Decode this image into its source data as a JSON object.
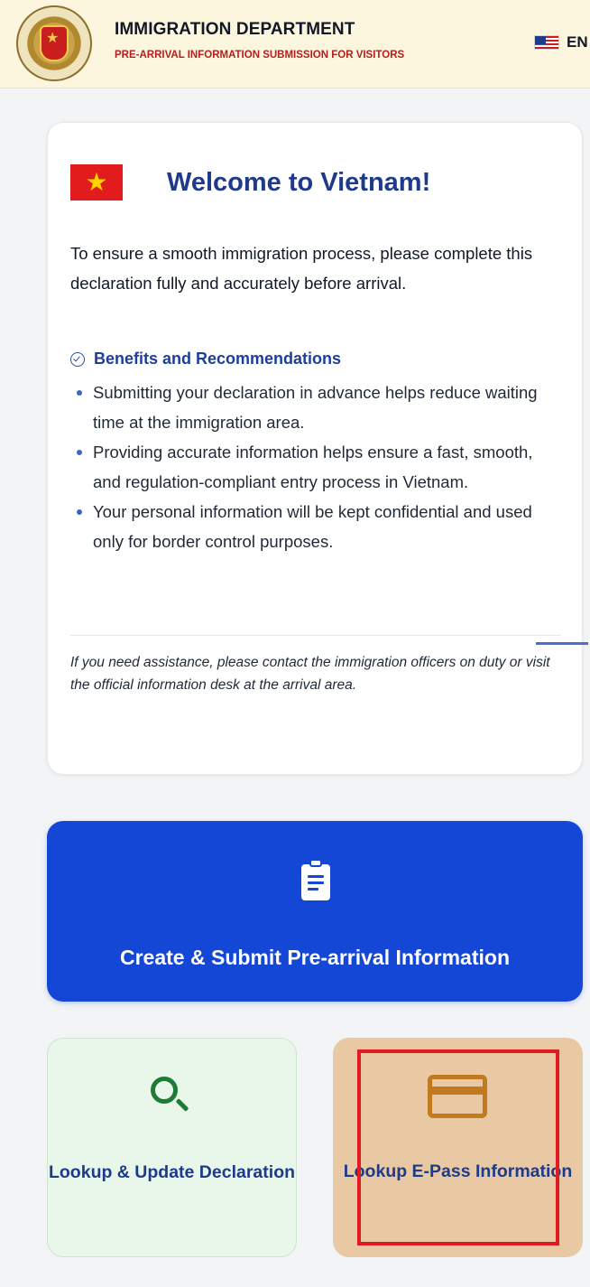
{
  "header": {
    "title": "IMMIGRATION DEPARTMENT",
    "subtitle": "PRE-ARRIVAL INFORMATION SUBMISSION FOR VISITORS",
    "language_code": "EN",
    "emblem_icon": "immigration-emblem",
    "flag_icon": "us-flag-icon"
  },
  "welcome": {
    "title": "Welcome to Vietnam!",
    "flag_icon": "vietnam-flag-icon",
    "intro": "To ensure a smooth immigration process, please complete this declaration fully and accurately before arrival.",
    "benefits_title": "Benefits and Recommendations",
    "benefits": [
      "Submitting your declaration in advance helps reduce waiting time at the immigration area.",
      "Providing accurate information helps ensure a fast, smooth, and regulation-compliant entry process in Vietnam.",
      "Your personal information will be kept confidential and used only for border control purposes."
    ],
    "assistance_note": "If you need assistance, please contact the immigration officers on duty or visit the official information desk at the arrival area."
  },
  "actions": {
    "create_label": "Create & Submit Pre-arrival Information",
    "lookup_declaration_label": "Lookup & Update Declaration",
    "lookup_epass_label": "Lookup E-Pass Information"
  },
  "colors": {
    "primary": "#1447d6",
    "navy": "#1e3a8a",
    "header_bg": "#fdf6df",
    "subtitle_red": "#b91c1c",
    "lookup_green_bg": "#e9f6ea",
    "lookup_green_icon": "#1e7a34",
    "epass_bg": "#e8c9a3",
    "epass_icon": "#c27a1f",
    "highlight_red": "#e01b24"
  }
}
